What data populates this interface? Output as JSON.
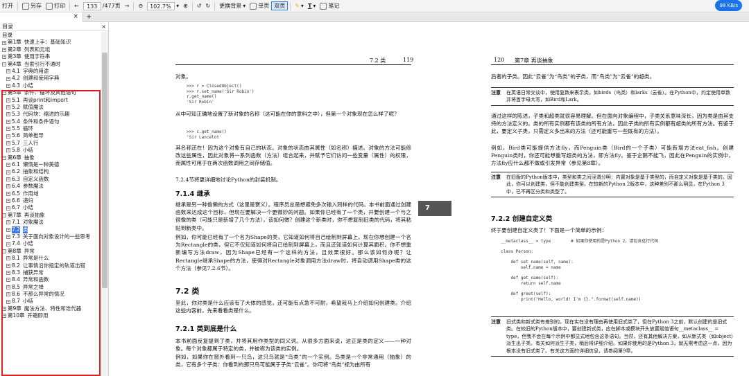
{
  "toolbar": {
    "open": "打开",
    "saveas": "另存",
    "print": "打印",
    "page_current": "133",
    "page_total": "/477页",
    "zoom": "102.7%",
    "bg": "更换背景",
    "single": "单页",
    "double": "双页",
    "pen": "T",
    "notes": "笔记",
    "speed": "98 KB/s"
  },
  "sidebar": {
    "title": "目录",
    "items": [
      {
        "level": "top",
        "text": "目录"
      },
      {
        "level": "top",
        "text": "第1章",
        "title": "快速上手：基础知识",
        "exp": "+"
      },
      {
        "level": "top",
        "text": "第2章",
        "title": "列表和元组",
        "exp": "+"
      },
      {
        "level": "top",
        "text": "第3章",
        "title": "使用字符串",
        "exp": "+"
      },
      {
        "level": "top",
        "text": "第4章",
        "title": "当索引行不通时",
        "exp": "−"
      },
      {
        "level": "sub",
        "text": "4.1",
        "title": "字典的用途",
        "exp": "+"
      },
      {
        "level": "sub",
        "text": "4.2",
        "title": "创建和使用字典",
        "exp": "+"
      },
      {
        "level": "sub",
        "text": "4.3",
        "title": "小结",
        "exp": "+"
      },
      {
        "level": "top",
        "text": "第5章",
        "title": "条件、循环及其他语句",
        "exp": "−"
      },
      {
        "level": "sub",
        "text": "5.1",
        "title": "再谈print和import",
        "exp": "+"
      },
      {
        "level": "sub",
        "text": "5.2",
        "title": "赋值魔法",
        "exp": "+"
      },
      {
        "level": "sub",
        "text": "5.3",
        "title": "代码块：缩进的乐趣",
        "exp": "+"
      },
      {
        "level": "sub",
        "text": "5.4",
        "title": "条件和条件语句",
        "exp": "+"
      },
      {
        "level": "sub",
        "text": "5.5",
        "title": "循环",
        "exp": "+"
      },
      {
        "level": "sub",
        "text": "5.6",
        "title": "简单推导",
        "exp": "+"
      },
      {
        "level": "sub",
        "text": "5.7",
        "title": "三人行",
        "exp": "+"
      },
      {
        "level": "sub",
        "text": "5.8",
        "title": "小结",
        "exp": "+"
      },
      {
        "level": "top",
        "text": "第6章",
        "title": "抽象",
        "exp": "−"
      },
      {
        "level": "sub",
        "text": "6.1",
        "title": "懒惰是一种美德",
        "exp": "+"
      },
      {
        "level": "sub",
        "text": "6.2",
        "title": "抽象和结构",
        "exp": "+"
      },
      {
        "level": "sub",
        "text": "6.3",
        "title": "自定义函数",
        "exp": "+"
      },
      {
        "level": "sub",
        "text": "6.4",
        "title": "参数魔法",
        "exp": "+"
      },
      {
        "level": "sub",
        "text": "6.5",
        "title": "作用域",
        "exp": "+"
      },
      {
        "level": "sub",
        "text": "6.6",
        "title": "递归",
        "exp": "+"
      },
      {
        "level": "sub",
        "text": "6.7",
        "title": "小结",
        "exp": "+"
      },
      {
        "level": "top",
        "text": "第7章",
        "title": "再谈抽象",
        "exp": "−"
      },
      {
        "level": "sub",
        "text": "7.1",
        "title": "对象魔法",
        "exp": "+"
      },
      {
        "level": "sub",
        "text": "7.2",
        "title": "类",
        "exp": "+",
        "selected": true
      },
      {
        "level": "sub",
        "text": "7.3",
        "title": "关于面向对象设计的一些思考",
        "exp": "+"
      },
      {
        "level": "sub",
        "text": "7.4",
        "title": "小结",
        "exp": "+"
      },
      {
        "level": "top",
        "text": "第8章",
        "title": "异常",
        "exp": "−"
      },
      {
        "level": "sub",
        "text": "8.1",
        "title": "异常是什么",
        "exp": "+"
      },
      {
        "level": "sub",
        "text": "8.2",
        "title": "让事情沿你指定的轨道出错",
        "exp": "+"
      },
      {
        "level": "sub",
        "text": "8.3",
        "title": "捕获异常",
        "exp": "+"
      },
      {
        "level": "sub",
        "text": "8.4",
        "title": "异常和函数",
        "exp": "+"
      },
      {
        "level": "sub",
        "text": "8.5",
        "title": "异常之禅",
        "exp": "+"
      },
      {
        "level": "sub",
        "text": "8.6",
        "title": "不那么异常的情况",
        "exp": "+"
      },
      {
        "level": "sub",
        "text": "8.7",
        "title": "小结",
        "exp": "+"
      },
      {
        "level": "top",
        "text": "第9章",
        "title": "魔法方法、特性和迭代器",
        "exp": "+"
      },
      {
        "level": "top",
        "text": "第10章",
        "title": "开箱即用",
        "exp": "+"
      }
    ]
  },
  "left_page": {
    "header_sec": "7.2  类",
    "header_num": "119",
    "p0": "对象。",
    "code1": ">>> r = ClosedObject()\n>>> r.set_name('Sir Robin')\nr.get_name()\n'Sir Robin'",
    "p1": "从中可知正确地设置了新对象的名称（这可能在你的意料之中），但第一个对象现在怎么样了呢？",
    "code2": ">>> c.get_name()\n'Sir Lancelot'",
    "p2": "其名称还在！因为这个对象有自己的状态。对象的状态由其属性（如名称）描述。对象的方法可能修改这些属性，因此对象将一系列函数（方法）组合起来，并赋予它们访问一些变量（属性）的权限，而属性可用于在两次函数调用之间存储值。",
    "p3": "7.2.4节将更详细地讨论Python的封装机制。",
    "h_inherit": "7.1.4  继承",
    "p4": "继承是另一种偷懒的方式（这里是褒义）。程序员总是想避免多次输入同样的代码。本书前面通过创建函数来达成这个目标，但现在要解决一个更微妙的问题。如果你已经有了一个类，并要创建一个与之很像的类（可能只是新增了几个方法），该如何做？创建这个新类时，你不想复制旧类的代码，将其粘贴到新类中。",
    "p5": "例如，你可能已经有了一个名为Shape的类，它知道如何将自己绘制到屏幕上。现在你想创建一个名为Rectangle的类，但它不仅知道如何将自己绘制到屏幕上，而且还知道如何计算其面积。你不想重新编写方法draw，因为Shape已经有一个这样的方法，且效果很好。那么该如何办呢？让Rectangle继承Shape的方法，使得对Rectangle对象调用方法draw时，将自动调用Shape类的这个方法（参见7.2.6节）。",
    "h_class": "7.2  类",
    "p6": "至此，你对类是什么应该有了大体的感觉，还可能有点急不可耐，希望我马上介绍如何创建类。介绍这些内容前，先来看看类是什么。",
    "h_what": "7.2.1  类到底是什么",
    "p7": "本书前面反复提到了类，并将其用作类型的同义词。从很多方面来说，这正是类的定义——一种对象。每个对象都属于特定的类，并被称为该类的实例。",
    "p8": "例如，如果你在窗外看到一只鸟，这只鸟就是“鸟类”的一个实例。鸟类是一个非常通用（抽象）的类，它有多个子类：你看到的那只鸟可能属于子类“云雀”。你可将“鸟类”视为由所有"
  },
  "right_page": {
    "header_num": "120",
    "header_sec": "第7章  再谈抽象",
    "p0": "后者的子类。因此“云雀”为“鸟类”的子类，而“鸟类”为“云雀”的超类。",
    "note1_tag": "注意",
    "note1": "在英语日常交谈中，使用复数来表示类，如birds（鸟类）和larks（云雀）。在Python中，约定使用单数并将首字母大写，如Bird和Lark。",
    "p1": "通过这样的陈述，子类和超类就很容易理解。但在面向对象编程中，子类关系意味深长，因为类是由其支持的方法定义的。类的所有实例都有该类的所有方法，因此子类的所有实例都有超类的所有方法。有鉴于此，要定义子类，只需定义多出来的方法（还可能重写一些既有的方法）。",
    "p2": "例如，Bird类可能提供方法fly，而Penguin类（Bird的一个子类）可能新增方法eat_fish。创建Penguin类时，你还可能想重写超类的方法，即方法fly。鉴于企鹅不能飞，因此在Penguin的实例中，方法fly应什么都不做或引发异常（参见第8章）。",
    "note2_tag": "注意",
    "note2": "在旧版的Python版本中，类型和类之间泾渭分明：内置对象是基于类型的，而自定义对象是基于类的。因此，你可以创建类，但不能创建类型。在较新的Python 2版本中，这种差别不那么明显，在Python 3中，已不再区分类和类型了。",
    "h_custom": "7.2.2  创建自定义类",
    "p3": "终于要创建自定义类了！下面是一个简单的示例：",
    "code1": "__metaclass__ = type        # 如果你使用的是Python 2，请包含这行代码\n\nclass Person:\n\n    def set_name(self, name):\n        self.name = name\n\n    def get_name(self):\n        return self.name\n\n    def greet(self):\n        print(\"Hello, world! I'm {}.\".format(self.name))",
    "note3_tag": "注意",
    "note3": "旧式类和新式类有差别的。现在实在没有理由再使用旧式类了，但在Python 3之前，默认创建的是旧式类。在较旧的Python版本中，要创建新式类，应在脚本或模块开头放置赋值语句__metaclass__ = type，但我不会在每个示例中都显式地包含这条语句。当然，还有其他解决方案，如从新式类（如object）派生出子类。有关如何派生子类，稍后将详细介绍。如果你使用的是Python 3，就无需考虑这一点，因为根本没有旧式类了。有关这方面的详细信息，请参阅第9章。"
  },
  "chapter_tab": "7"
}
